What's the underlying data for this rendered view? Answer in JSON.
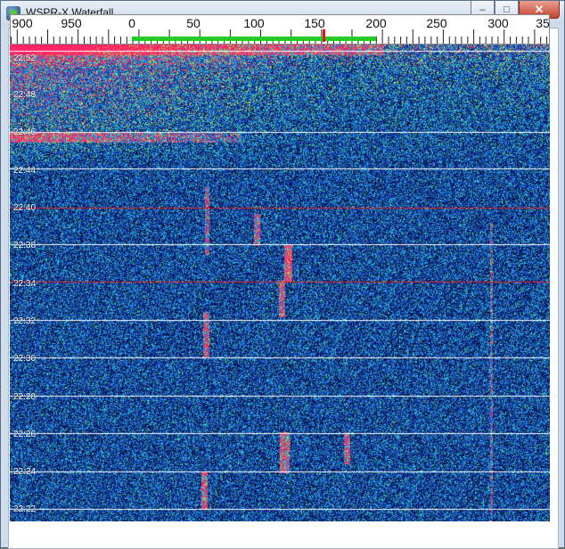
{
  "window": {
    "title": "WSPR-X Waterfall",
    "icon": "globe-icon"
  },
  "controls": {
    "minimize": "‒",
    "maximize": "□",
    "close": "✕"
  },
  "scale": {
    "labels": [
      "900",
      "950",
      "0",
      "50",
      "100",
      "150",
      "200",
      "250",
      "300",
      "35"
    ],
    "band_color": "#22cc22",
    "marker_color": "#e81010"
  },
  "waterfall": {
    "times": [
      "22:52",
      "22:48",
      "22:46",
      "22:44",
      "22:40",
      "22:38",
      "22:34",
      "22:32",
      "22:30",
      "22:28",
      "22:26",
      "22:24",
      "22:22"
    ],
    "colors": {
      "background": "#081040",
      "noise": "#1f6fd0",
      "signal": "#40d070",
      "strong": "#ff2060",
      "separator": "#ffffff",
      "red_separator": "#e02020"
    }
  }
}
